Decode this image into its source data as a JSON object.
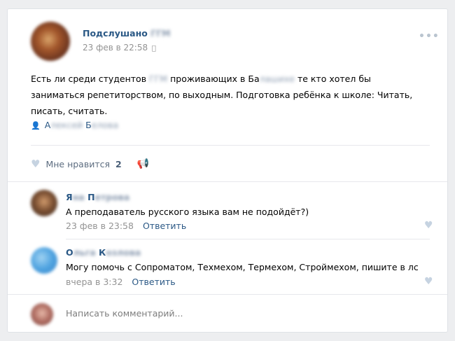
{
  "post": {
    "author_prefix": "Подслушано",
    "author_blurred": "ГГМ",
    "time": "23 фев в 22:58",
    "text_part1": "Есть ли среди студентов",
    "text_blur1": "ГГМ",
    "text_part2": "проживающих в Ба",
    "text_blur2": "лашихе",
    "text_part3": "те кто хотел бы заниматься репетиторством, по выходным. Подготовка ребёнка к школе: Читать, писать, считать.",
    "signer_first": "А",
    "signer_blur1": "лексей",
    "signer_last": "Б",
    "signer_blur2": "елова",
    "like_label": "Мне нравится",
    "like_count": "2"
  },
  "comments": [
    {
      "author_a": "Я",
      "author_blur1": "на",
      "author_b": "П",
      "author_blur2": "етрова",
      "text": "А преподаватель русского языка вам не подойдёт?)",
      "time": "23 фев в 23:58",
      "reply": "Ответить"
    },
    {
      "author_a": "О",
      "author_blur1": "льга",
      "author_b": "К",
      "author_blur2": "озлова",
      "text": "Могу помочь с Сопроматом, Техмехом, Термехом, Строймехом, пишите в лс",
      "time": "вчера в 3:32",
      "reply": "Ответить"
    }
  ],
  "comment_input": {
    "placeholder": "Написать комментарий..."
  },
  "icons": {
    "more": "more-dots-icon",
    "apple": "apple-icon",
    "person": "person-icon",
    "heart": "heart-icon",
    "share": "megaphone-icon"
  },
  "colors": {
    "link": "#2a5885",
    "background": "#edeef0",
    "muted": "#939393"
  }
}
